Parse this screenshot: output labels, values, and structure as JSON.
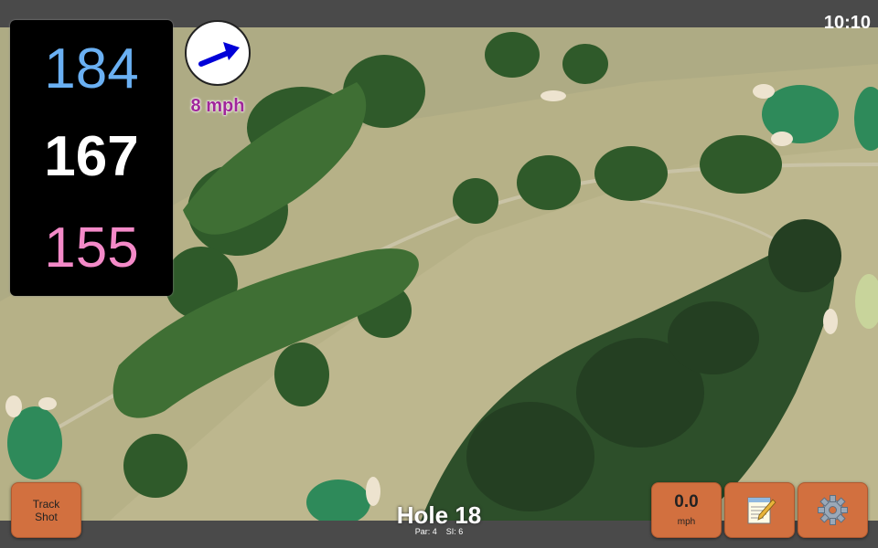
{
  "status": {
    "time": "10:10"
  },
  "yardage": {
    "back": "184",
    "center": "167",
    "front": "155"
  },
  "wind": {
    "speed": "8 mph",
    "direction_icon": "arrow-icon"
  },
  "hole": {
    "title": "Hole 18",
    "par": "Par: 4",
    "si": "SI: 6"
  },
  "buttons": {
    "track_shot": "Track\nShot",
    "speed_value": "0.0",
    "speed_unit": "mph",
    "notes_icon": "notepad-icon",
    "settings_icon": "gear-icon"
  },
  "colors": {
    "back": "#6ab0f3",
    "center": "#ffffff",
    "front": "#f48ac8",
    "wind_text": "#a0269a",
    "button": "#d2703f"
  }
}
